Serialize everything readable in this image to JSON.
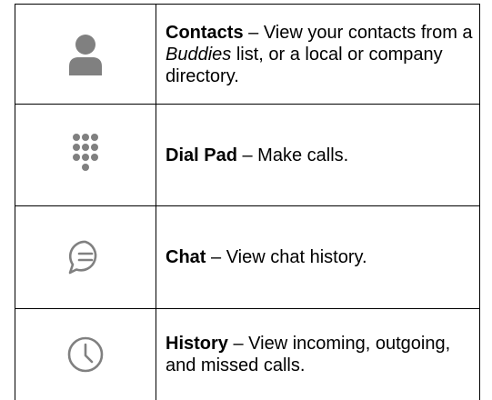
{
  "rows": [
    {
      "icon": "person-icon",
      "term": "Contacts",
      "desc_before": " – View your contacts from a ",
      "desc_italic": "Buddies",
      "desc_after": " list, or a local or company directory."
    },
    {
      "icon": "dialpad-icon",
      "term": "Dial Pad",
      "desc": " – Make calls."
    },
    {
      "icon": "chat-bubble-icon",
      "term": "Chat",
      "desc": " – View chat history."
    },
    {
      "icon": "clock-icon",
      "term": "History",
      "desc": " – View incoming, outgoing, and missed calls."
    }
  ],
  "colors": {
    "icon_gray": "#808080",
    "border": "#000000"
  }
}
